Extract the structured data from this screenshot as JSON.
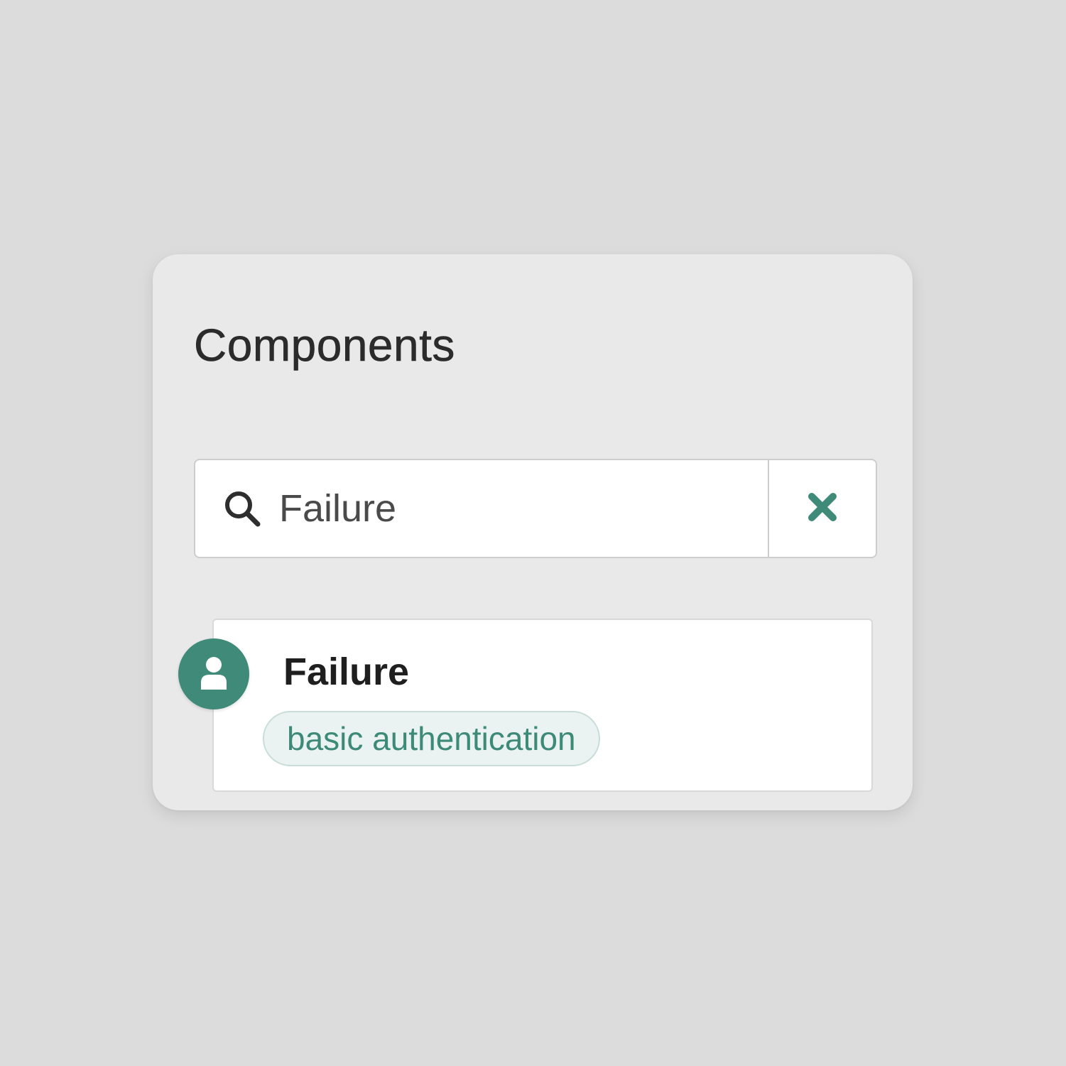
{
  "panel": {
    "title": "Components"
  },
  "search": {
    "value": "Failure",
    "icon": "search-icon",
    "clear_icon": "close-icon"
  },
  "results": [
    {
      "name": "Failure",
      "icon": "user-icon",
      "tag": "basic authentication"
    }
  ],
  "colors": {
    "accent": "#3f8a78",
    "tag_background": "#eaf3f1",
    "tag_text": "#3c8a77",
    "panel_background": "#e9e9e9",
    "page_background": "#dcdcdc"
  }
}
